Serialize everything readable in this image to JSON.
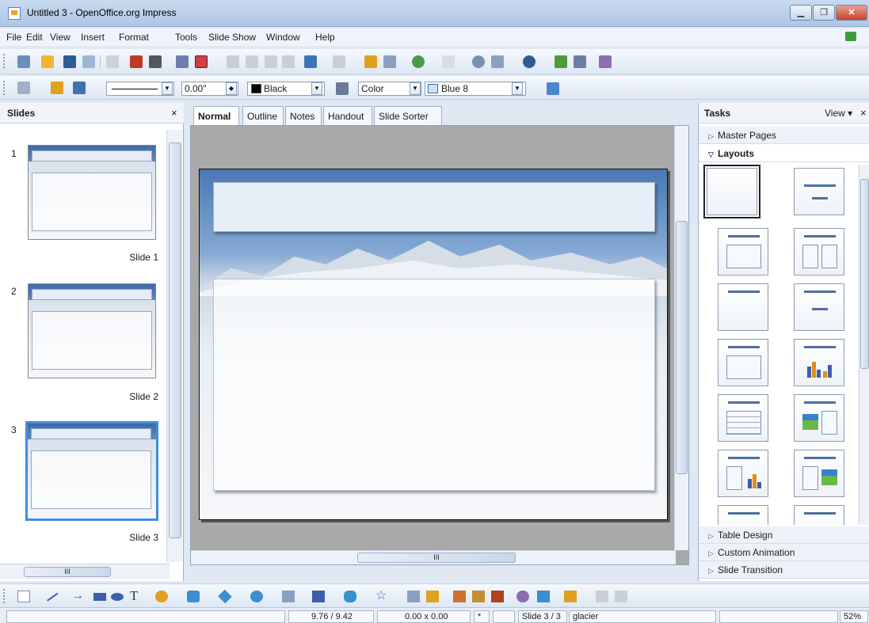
{
  "window": {
    "title": "Untitled 3 - OpenOffice.org Impress"
  },
  "menu": [
    "File",
    "Edit",
    "View",
    "Insert",
    "Format",
    "Tools",
    "Slide Show",
    "Window",
    "Help"
  ],
  "format_bar": {
    "line_width": "0.00\"",
    "line_color": "Black",
    "area_style": "Color",
    "area_color": "Blue 8"
  },
  "slides_panel": {
    "title": "Slides",
    "close": "×",
    "slides": [
      {
        "number": "1",
        "label": "Slide 1",
        "selected": false
      },
      {
        "number": "2",
        "label": "Slide 2",
        "selected": false
      },
      {
        "number": "3",
        "label": "Slide 3",
        "selected": true
      }
    ]
  },
  "view_tabs": [
    {
      "label": "Normal",
      "active": true
    },
    {
      "label": "Outline",
      "active": false
    },
    {
      "label": "Notes",
      "active": false
    },
    {
      "label": "Handout",
      "active": false
    },
    {
      "label": "Slide Sorter",
      "active": false
    }
  ],
  "tasks_panel": {
    "title": "Tasks",
    "view_label": "View",
    "close": "×",
    "sections_top": [
      {
        "label": "Master Pages",
        "open": false
      },
      {
        "label": "Layouts",
        "open": true
      }
    ],
    "sections_bottom": [
      {
        "label": "Table Design",
        "open": false
      },
      {
        "label": "Custom Animation",
        "open": false
      },
      {
        "label": "Slide Transition",
        "open": false
      }
    ]
  },
  "statusbar": {
    "position": "9.76 / 9.42",
    "size": "0.00 x 0.00",
    "modified": "*",
    "slide": "Slide 3 / 3",
    "master": "glacier",
    "zoom": "52%"
  },
  "scroll_glyph": "III",
  "colors": {
    "accent": "#3c8ee6",
    "panel_bg": "#dfe8f3",
    "editor_bg": "#a9a9a9"
  }
}
